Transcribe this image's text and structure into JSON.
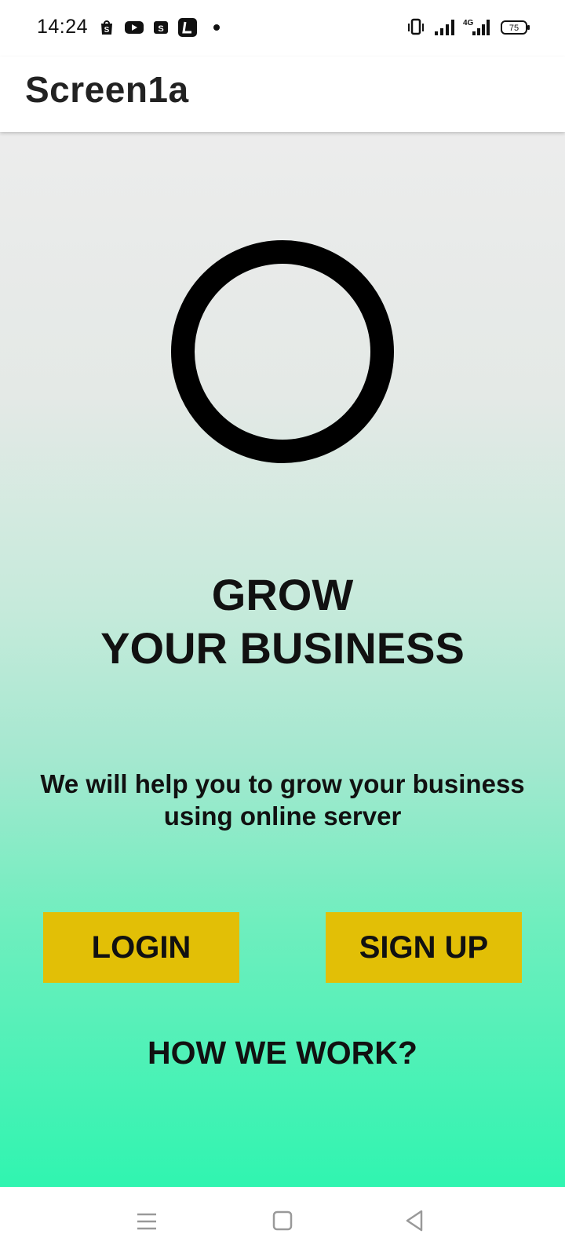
{
  "status_bar": {
    "time": "14:24",
    "notification_icons": [
      "shopping-bag-icon",
      "youtube-icon",
      "shopping-bag-icon",
      "l-app-icon"
    ],
    "battery_level": "75",
    "network_label": "4G"
  },
  "app_bar": {
    "title": "Screen1a"
  },
  "hero": {
    "headline_line1": "GROW",
    "headline_line2": "YOUR BUSINESS",
    "subtext_line1": "We will help you to grow your business",
    "subtext_line2": "using online server"
  },
  "actions": {
    "login_label": "LOGIN",
    "signup_label": "SIGN UP",
    "how_label": "HOW WE WORK?"
  },
  "colors": {
    "button_bg": "#e2bf06",
    "gradient_top": "#ececec",
    "gradient_bottom": "#30f4b0",
    "text": "#111111"
  },
  "nav_bar": {
    "icons": [
      "menu-icon",
      "home-square-icon",
      "back-triangle-icon"
    ]
  }
}
